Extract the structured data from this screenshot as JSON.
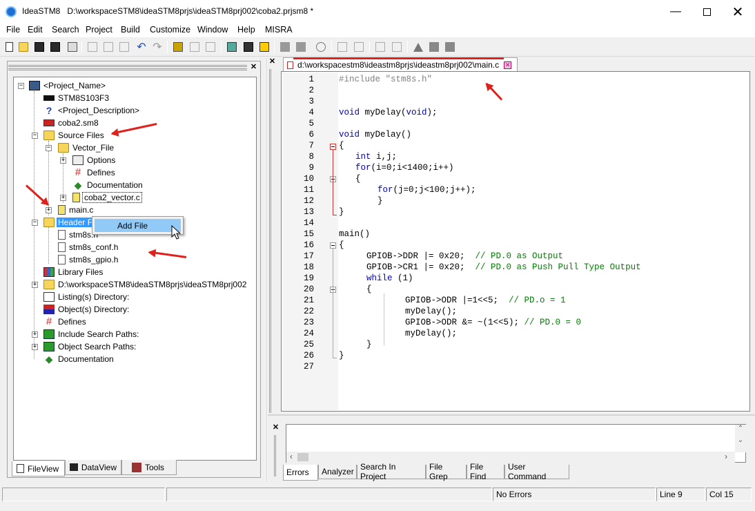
{
  "window": {
    "app_name": "IdeaSTM8",
    "path": "D:\\workspaceSTM8\\ideaSTM8prjs\\ideaSTM8prj002\\coba2.prjsm8 *"
  },
  "menu": [
    "File",
    "Edit",
    "Search",
    "Project",
    "Build",
    "Customize",
    "Window",
    "Help",
    "MISRA"
  ],
  "tree": {
    "project_name": "<Project_Name>",
    "device": "STM8S103F3",
    "description": "<Project_Description>",
    "sm8_file": "coba2.sm8",
    "source_files": "Source Files",
    "vector_file": "Vector_File",
    "options": "Options",
    "defines": "Defines",
    "documentation": "Documentation",
    "vector_c": "coba2_vector.c",
    "main_c": "main.c",
    "header_files": "Header Fi",
    "h1": "stm8s.h",
    "h2": "stm8s_conf.h",
    "h3": "stm8s_gpio.h",
    "library_files": "Library Files",
    "root_dir": "D:\\workspaceSTM8\\ideaSTM8prjs\\ideaSTM8prj002",
    "listing_dir": "Listing(s) Directory:",
    "object_dir": "Object(s) Directory:",
    "defines2": "Defines",
    "include_paths": "Include Search Paths:",
    "object_paths": "Object Search Paths:",
    "documentation2": "Documentation"
  },
  "context_menu": {
    "add_file": "Add File"
  },
  "left_tabs": [
    "FileView",
    "DataView",
    "Tools"
  ],
  "editor": {
    "tab_title": "d:\\workspacestm8\\ideastm8prjs\\ideastm8prj002\\main.c",
    "line_numbers": [
      "1",
      "2",
      "3",
      "4",
      "5",
      "6",
      "7",
      "8",
      "9",
      "10",
      "11",
      "12",
      "13",
      "14",
      "15",
      "16",
      "17",
      "18",
      "19",
      "20",
      "21",
      "22",
      "23",
      "24",
      "25",
      "26",
      "27"
    ],
    "code": {
      "l1": "#include \"stm8s.h\"",
      "l4a": "void",
      "l4b": " myDelay(",
      "l4c": "void",
      "l4d": ");",
      "l6a": "void",
      "l6b": " myDelay()",
      "l7": "{",
      "l8a": "int",
      "l8b": " i,j;",
      "l9a": "for",
      "l9b": "(i=0;i<1400;i++)",
      "l10": "{",
      "l11a": "for",
      "l11b": "(j=0;j<100;j++);",
      "l12": "}",
      "l13": "}",
      "l15": "main()",
      "l16": "{",
      "l17a": "GPIOB->DDR |= 0x20;  ",
      "l17b": "// PD.0 as Output",
      "l18a": "GPIOB->CR1 |= 0x20;  ",
      "l18b": "// PD.0 as Push Pull Type Output",
      "l19a": "while",
      "l19b": " (1)",
      "l20": "{",
      "l21a": "GPIOB->ODR |=1<<5;  ",
      "l21b": "// PD.o = 1",
      "l22": "myDelay();",
      "l23a": "GPIOB->ODR &= ~(1<<5); ",
      "l23b": "// PD.0 = 0",
      "l24": "myDelay();",
      "l25": "}",
      "l26": "}"
    }
  },
  "output_tabs": [
    "Errors",
    "Analyzer",
    "Search In Project",
    "File Grep",
    "File Find",
    "User Command"
  ],
  "status": {
    "errors": "No Errors",
    "line": "Line 9",
    "col": "Col 15"
  },
  "colors": {
    "keyword": "#0000c8",
    "comment": "#008000",
    "annotation": "#e0201a",
    "selection": "#3399ff"
  }
}
